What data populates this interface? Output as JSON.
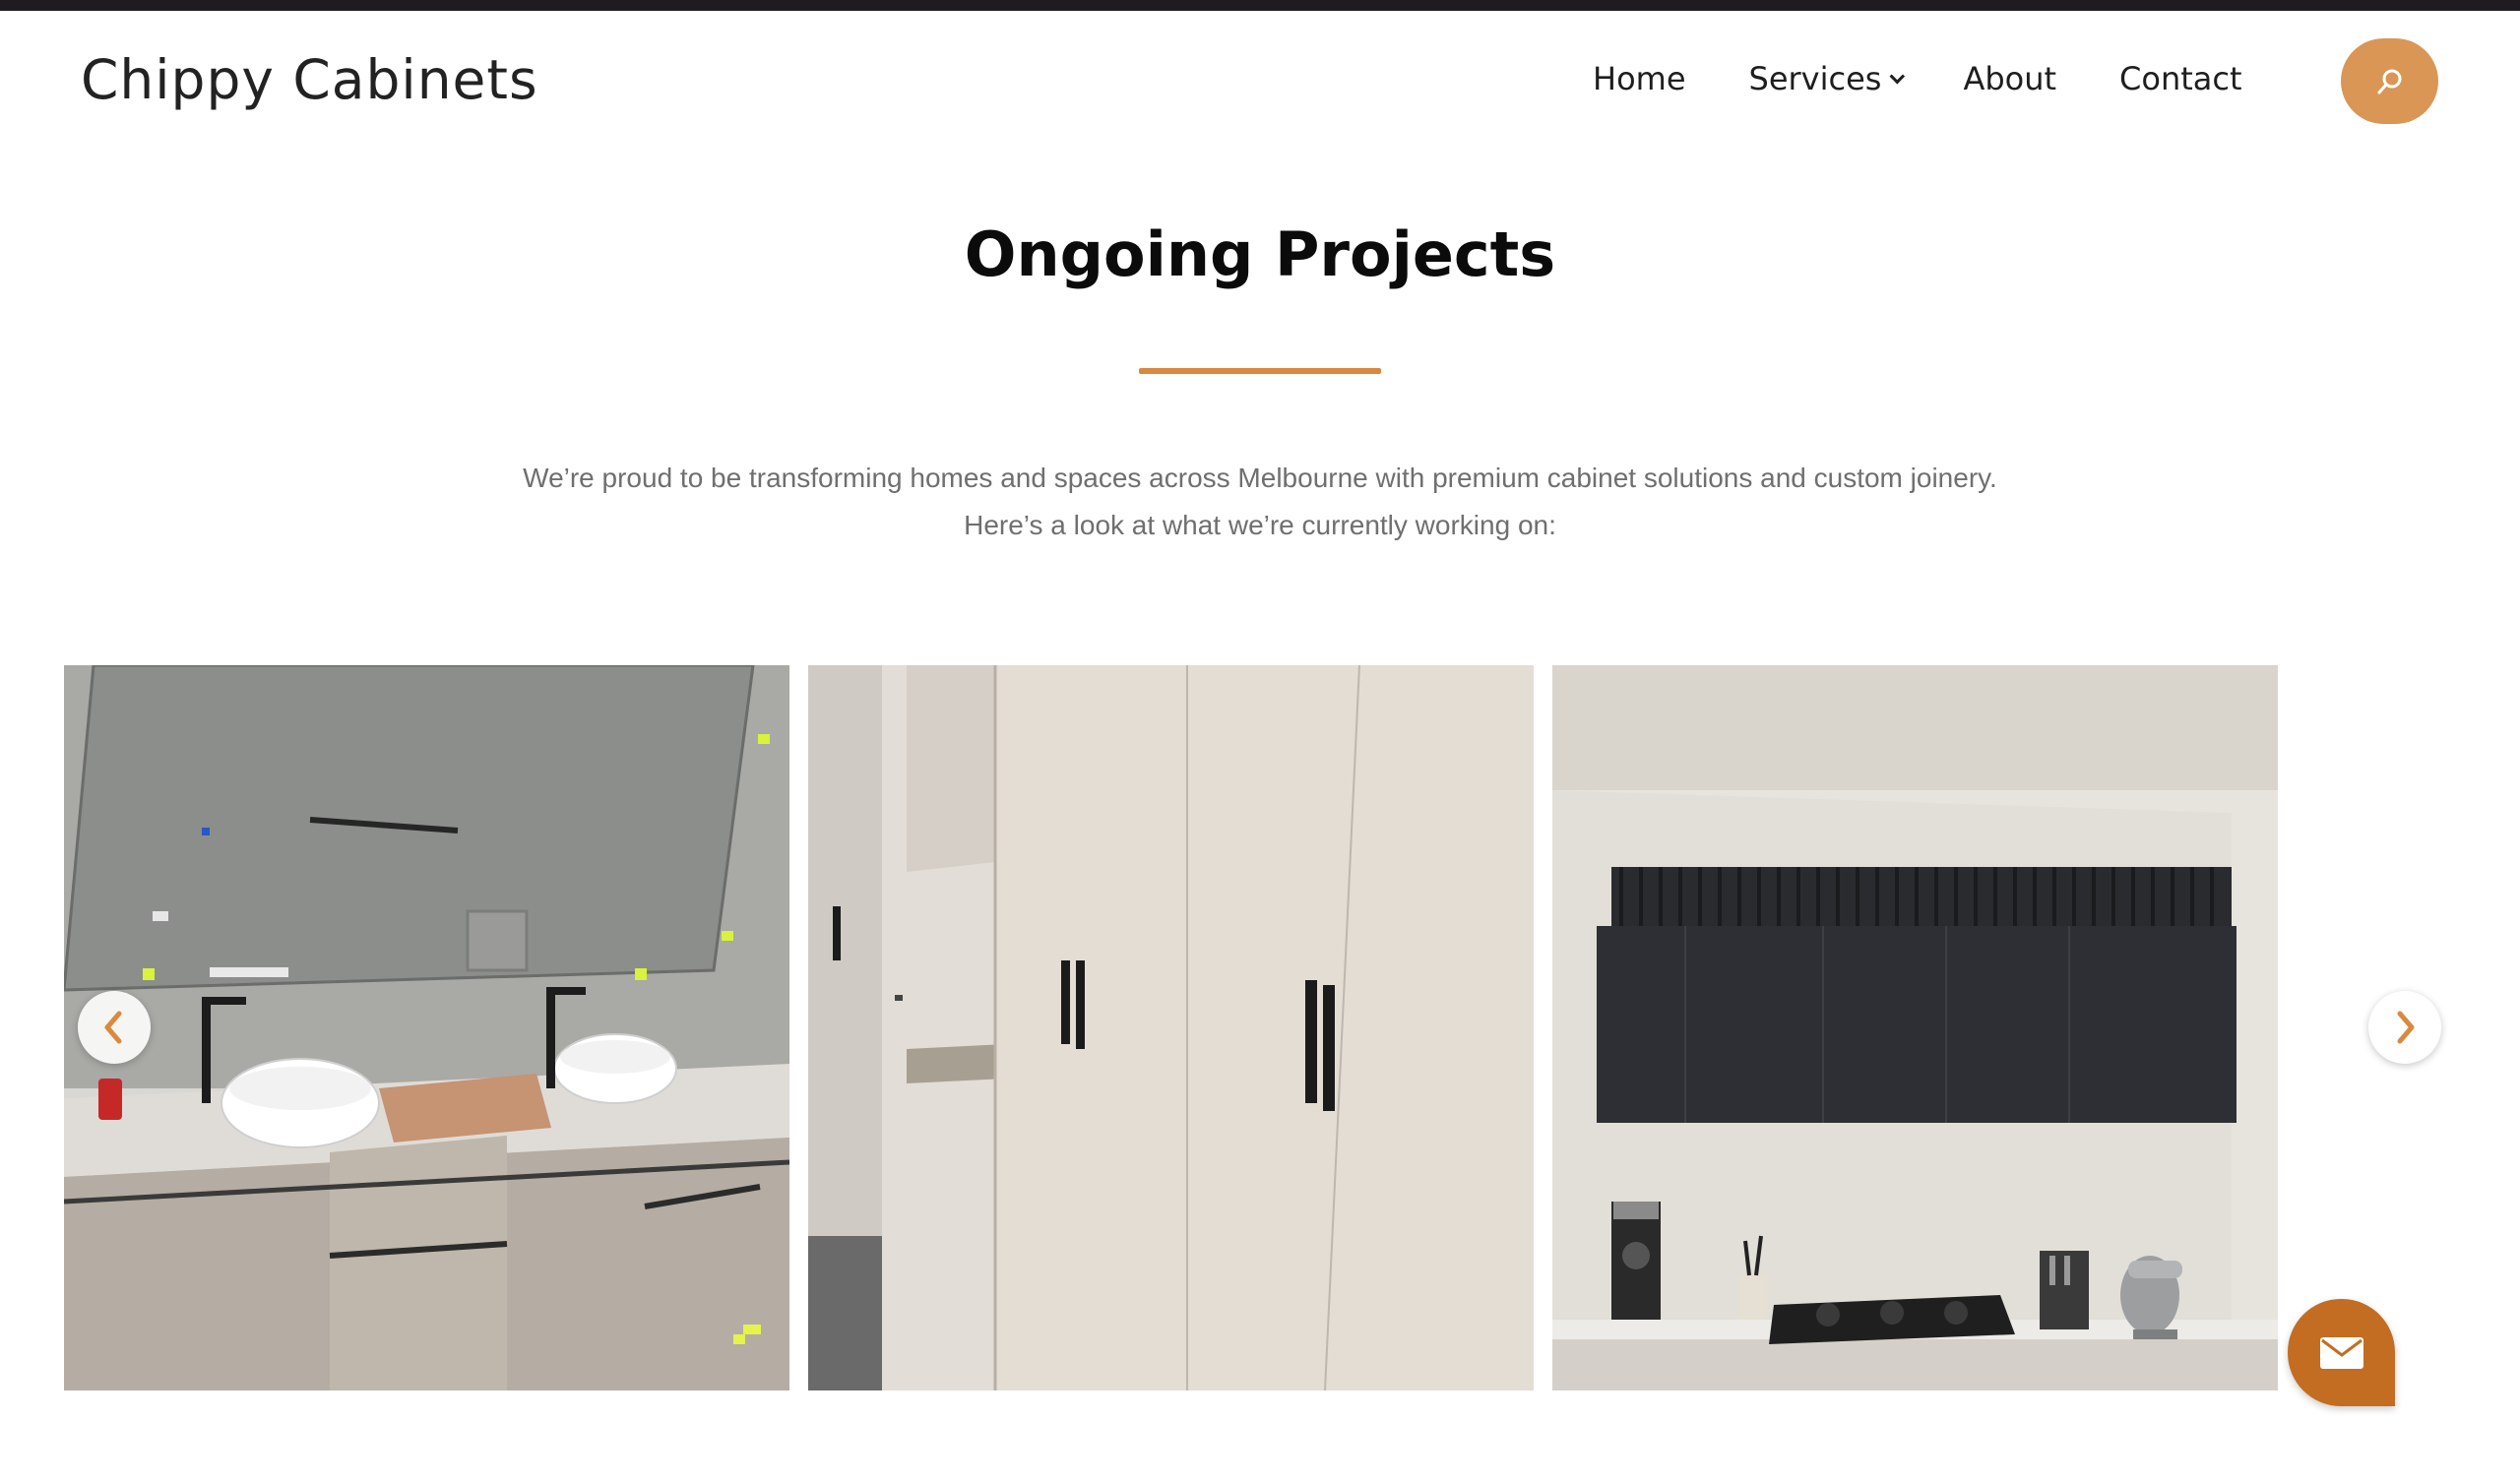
{
  "header": {
    "logo": "Chippy Cabinets",
    "nav": [
      {
        "label": "Home"
      },
      {
        "label": "Services",
        "has_dropdown": true
      },
      {
        "label": "About"
      },
      {
        "label": "Contact"
      }
    ],
    "search_icon": "search-icon"
  },
  "section": {
    "title": "Ongoing Projects",
    "intro_line1": "We’re proud to be transforming homes and spaces across Melbourne with premium cabinet solutions and custom joinery.",
    "intro_line2": "Here’s a look at what we’re currently working on:"
  },
  "carousel": {
    "prev_icon": "chevron-left-icon",
    "next_icon": "chevron-right-icon",
    "slides": [
      {
        "subject": "bathroom-vanity-photo"
      },
      {
        "subject": "wardrobe-photo"
      },
      {
        "subject": "kitchen-cabinets-photo"
      }
    ]
  },
  "contact_fab": {
    "icon": "envelope-icon"
  },
  "colors": {
    "accent": "#d99655",
    "divider": "#d8883f",
    "fab": "#c36d22",
    "topbar": "#1e1c21",
    "text_muted": "#6f6f6f"
  }
}
